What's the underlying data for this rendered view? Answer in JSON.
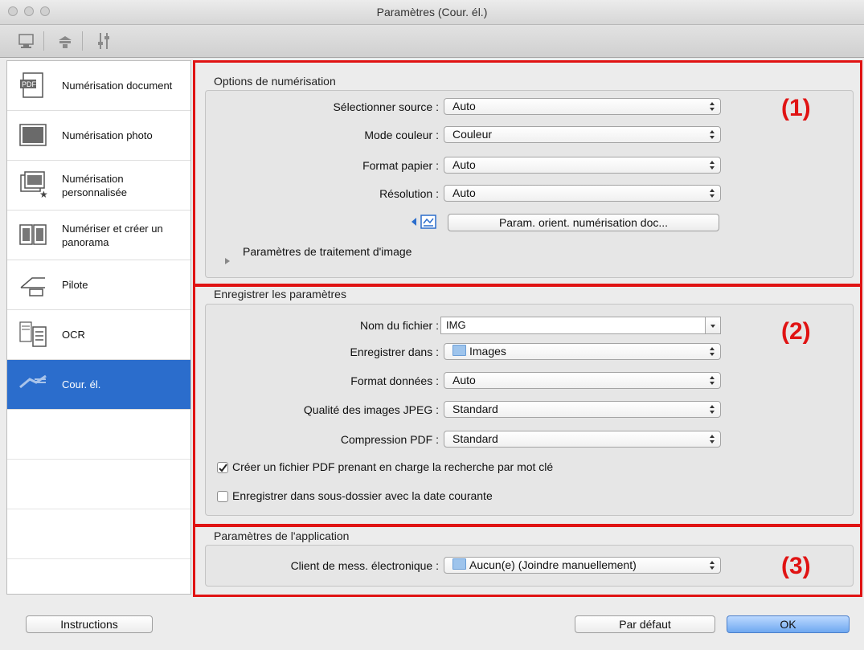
{
  "window": {
    "title": "Paramètres (Cour. él.)"
  },
  "toolbar": {
    "icons": [
      "scan-from-computer-icon",
      "scan-from-panel-icon",
      "general-settings-icon"
    ]
  },
  "sidebar": {
    "items": [
      {
        "label": "Numérisation document",
        "icon": "pdf-document-icon"
      },
      {
        "label": "Numérisation photo",
        "icon": "photo-icon"
      },
      {
        "label": "Numérisation personnalisée",
        "icon": "custom-scan-icon"
      },
      {
        "label": "Numériser et créer un panorama",
        "icon": "panorama-icon"
      },
      {
        "label": "Pilote",
        "icon": "driver-icon"
      },
      {
        "label": "OCR",
        "icon": "ocr-icon"
      },
      {
        "label": "Cour. él.",
        "icon": "email-icon",
        "selected": true
      }
    ]
  },
  "scan_options": {
    "title": "Options de numérisation",
    "source_label": "Sélectionner source :",
    "source_value": "Auto",
    "color_mode_label": "Mode couleur :",
    "color_mode_value": "Couleur",
    "paper_label": "Format papier :",
    "paper_value": "Auto",
    "resolution_label": "Résolution :",
    "resolution_value": "Auto",
    "orient_button": "Param. orient. numérisation doc...",
    "image_processing": "Paramètres de traitement d'image"
  },
  "save_settings": {
    "title": "Enregistrer les paramètres",
    "filename_label": "Nom du fichier :",
    "filename_value": "IMG",
    "save_in_label": "Enregistrer dans :",
    "save_in_value": "Images",
    "data_format_label": "Format données :",
    "data_format_value": "Auto",
    "jpeg_label": "Qualité des images JPEG :",
    "jpeg_value": "Standard",
    "pdf_comp_label": "Compression PDF :",
    "pdf_comp_value": "Standard",
    "searchable_pdf_label": "Créer un fichier PDF prenant en charge la recherche par mot clé",
    "searchable_pdf_checked": true,
    "subfolder_label": "Enregistrer dans sous-dossier avec la date courante",
    "subfolder_checked": false
  },
  "app_settings": {
    "title": "Paramètres de l'application",
    "email_client_label": "Client de mess. électronique :",
    "email_client_value": "Aucun(e) (Joindre manuellement)"
  },
  "annotations": {
    "one": "(1)",
    "two": "(2)",
    "three": "(3)",
    "color": "#e01313"
  },
  "footer": {
    "instructions": "Instructions",
    "defaults": "Par défaut",
    "ok": "OK"
  }
}
